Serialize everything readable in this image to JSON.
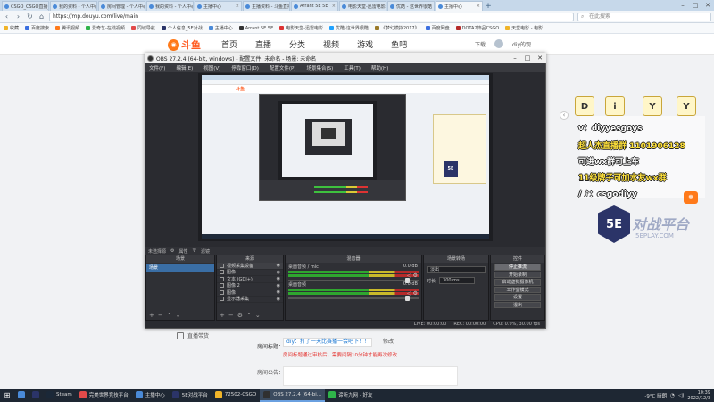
{
  "browser": {
    "tabs": [
      {
        "label": "CSGO_CSGO直播_CSGO视频",
        "active": false
      },
      {
        "label": "我的资料 - 个人中心 - 斗鱼",
        "active": false
      },
      {
        "label": "房间管理 - 个人中心 - 斗鱼",
        "active": false
      },
      {
        "label": "我的资料 - 个人中心 - 斗鱼",
        "active": false
      },
      {
        "label": "主播中心",
        "active": false
      },
      {
        "label": "主播资料 - 斗鱼直播平台",
        "active": false
      },
      {
        "label": "Arrant 5E 5E",
        "active": false
      },
      {
        "label": "电影天堂-迅雷电影",
        "active": false
      },
      {
        "label": "优酷 - 这世界很酷",
        "active": false
      },
      {
        "label": "主播中心",
        "active": true
      }
    ],
    "url": "https://mp.douyu.com/live/main",
    "search_placeholder": "在此搜索",
    "bookmarks": [
      {
        "label": "收藏",
        "color": "#f0b429"
      },
      {
        "label": "百度搜索",
        "color": "#3b6fe0"
      },
      {
        "label": "腾讯视频",
        "color": "#ff7a1a"
      },
      {
        "label": "爱奇艺-在线视频",
        "color": "#2fb34a"
      },
      {
        "label": "同城导航",
        "color": "#e24a4a"
      },
      {
        "label": "个人信息_5E对战",
        "color": "#2b3468"
      },
      {
        "label": "主播中心",
        "color": "#4a8ad8"
      },
      {
        "label": "Arrant 5E 5E",
        "color": "#333"
      },
      {
        "label": "电影天堂-迅雷电影",
        "color": "#d33"
      },
      {
        "label": "优酷-这世界很酷",
        "color": "#1fa2ff"
      },
      {
        "label": "《梦幻模拟2017》",
        "color": "#9a7a2a"
      },
      {
        "label": "百度网盘",
        "color": "#3b6fe0"
      },
      {
        "label": "DOTA2饰品CSGO",
        "color": "#b52a2a"
      },
      {
        "label": "天堂电影 - 电影",
        "color": "#f0b429"
      }
    ]
  },
  "douyu": {
    "logo_text": "斗鱼",
    "nav": [
      "首页",
      "直播",
      "分类",
      "视频",
      "游戏",
      "鱼吧"
    ],
    "download_label": "下载",
    "username": "diy的观",
    "side_entry_label": "直播带货",
    "room_announce_label": "房间标题：",
    "room_announce_value": "diy：打了一天比赛播一会吧下！！",
    "edit_label": "修改",
    "warning_text": "房间标题通过审核后，需要间隔10分钟才能再次修改",
    "room_notice_label": "房间公告："
  },
  "overlay": {
    "letters": [
      "D",
      "i",
      "Y",
      "Y"
    ],
    "lines": [
      {
        "text": "v：diyyesgoys",
        "yellow": false
      },
      {
        "text": "超人杰直播群 1101906128",
        "yellow": true
      },
      {
        "text": "可进wx群可上车",
        "yellow": false
      },
      {
        "text": "11级牌子可加水友wx群",
        "yellow": true
      },
      {
        "text": "/ ♪：csgodiyy",
        "yellow": false
      }
    ],
    "badge_text": "5E",
    "brand_text": "对战平台",
    "brand_sub": "5EPLAY.COM"
  },
  "obs": {
    "title": "OBS 27.2.4 (64-bit, windows) - 配置文件: 未命名 - 场景: 未命名",
    "menu": [
      "文件(F)",
      "编辑(E)",
      "视图(V)",
      "停靠窗口(D)",
      "配置文件(P)",
      "场景集合(S)",
      "工具(T)",
      "帮助(H)"
    ],
    "no_source_label": "未选择源",
    "props_label": "属性",
    "filters_label": "滤镜",
    "docks": {
      "scenes_title": "场景",
      "sources_title": "来源",
      "mixer_title": "混音器",
      "transitions_title": "场景转场",
      "controls_title": "控件"
    },
    "scenes": [
      "场景"
    ],
    "sources": [
      {
        "label": "视频采集设备",
        "selected": true
      },
      {
        "label": "图像",
        "selected": false
      },
      {
        "label": "文本 (GDI+)",
        "selected": false
      },
      {
        "label": "图像 2",
        "selected": false
      },
      {
        "label": "图像",
        "selected": false
      },
      {
        "label": "显示器采集",
        "selected": false
      }
    ],
    "mixer": [
      {
        "name": "桌面音频 / mic",
        "db": "0.0 dB"
      },
      {
        "name": "桌面音频",
        "db": "0.0 dB"
      }
    ],
    "transition_type": "淡出",
    "duration_label": "时长",
    "duration_value": "300 ms",
    "controls": [
      {
        "label": "停止推流",
        "active": true
      },
      {
        "label": "开始录制",
        "active": false
      },
      {
        "label": "启动虚拟摄像机",
        "active": false
      },
      {
        "label": "工作室模式",
        "active": false
      },
      {
        "label": "设置",
        "active": false
      },
      {
        "label": "退出",
        "active": false
      }
    ],
    "status": {
      "live": "LIVE: 00:00:00",
      "rec": "REC: 00:00:00",
      "cpu": "CPU: 0.9%, 30.00 fps"
    }
  },
  "taskbar": {
    "items": [
      {
        "label": "",
        "color": "#4a8ad8",
        "active": false
      },
      {
        "label": "",
        "color": "#2b3468",
        "active": false
      },
      {
        "label": "Steam",
        "color": "#1b2838",
        "active": false
      },
      {
        "label": "完美世界竞技平台",
        "color": "#e24a4a",
        "active": false
      },
      {
        "label": "主播中心",
        "color": "#4a8ad8",
        "active": false
      },
      {
        "label": "5E对战平台",
        "color": "#2b3468",
        "active": false
      },
      {
        "label": "72502-CSGO",
        "color": "#f0b429",
        "active": false
      },
      {
        "label": "OBS 27.2.4 (64-bi...",
        "color": "#303030",
        "active": true
      },
      {
        "label": "谛听九网 - 好友",
        "color": "#2fb34a",
        "active": false
      }
    ],
    "weather": "-9°C 晴朗",
    "time": "10:39",
    "date": "2022/12/3"
  }
}
